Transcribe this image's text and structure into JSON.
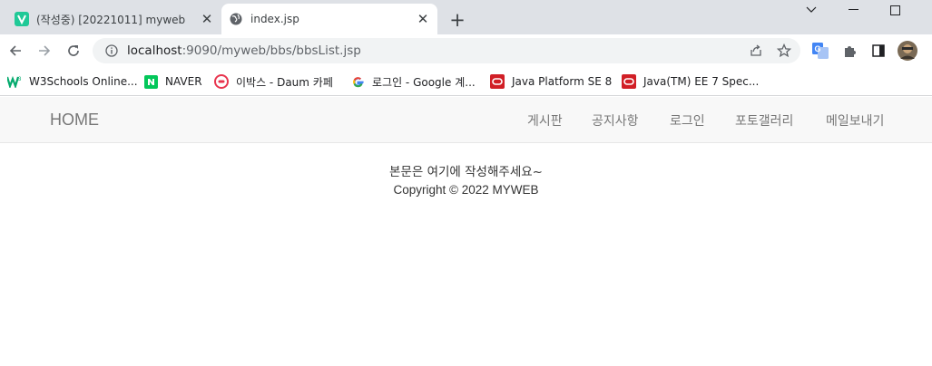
{
  "browser": {
    "tabs": [
      {
        "title": "(작성중) [20221011] myweb",
        "favicon": "v-favicon",
        "active": false
      },
      {
        "title": "index.jsp",
        "favicon": "globe-icon",
        "active": true
      }
    ],
    "url": {
      "host": "localhost",
      "rest": ":9090/myweb/bbs/bbsList.jsp"
    },
    "bookmarks": [
      {
        "label": "W3Schools Online...",
        "icon": "w3schools-icon"
      },
      {
        "label": "NAVER",
        "icon": "naver-icon"
      },
      {
        "label": "이박스 - Daum 카페",
        "icon": "daum-cafe-icon"
      },
      {
        "label": "로그인 - Google 계...",
        "icon": "google-icon"
      },
      {
        "label": "Java Platform SE 8",
        "icon": "oracle-icon"
      },
      {
        "label": "Java(TM) EE 7 Spec...",
        "icon": "oracle-icon"
      }
    ]
  },
  "site": {
    "brand": "HOME",
    "menu": [
      "게시판",
      "공지사항",
      "로그인",
      "포토갤러리",
      "메일보내기"
    ]
  },
  "content": {
    "body_text": "본문은 여기에 작성해주세요~",
    "footer": "Copyright © 2022 MYWEB"
  }
}
